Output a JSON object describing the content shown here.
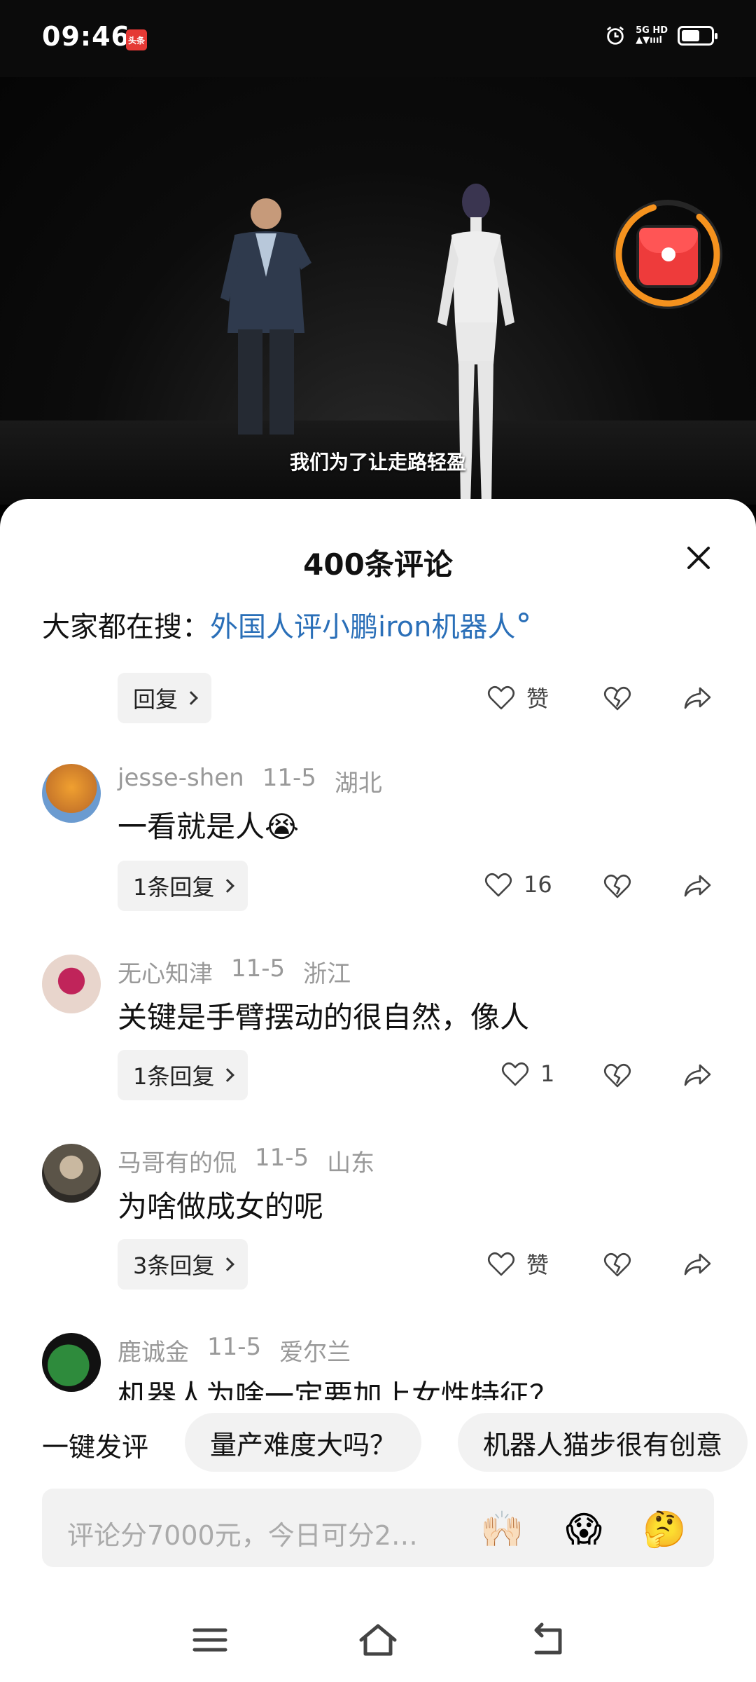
{
  "status_bar": {
    "time": "09:46",
    "app_badge": "头条",
    "network_top": "5G HD",
    "network_bottom": "▲▼ıııl",
    "battery_level": 0.55
  },
  "video": {
    "subtitle": "我们为了让走路轻盈"
  },
  "sheet": {
    "title": "400条评论",
    "search_prefix": "大家都在搜：",
    "search_link": "外国人评小鹏iron机器人"
  },
  "top_actions": {
    "reply_label": "回复",
    "like_label": "赞"
  },
  "comments": [
    {
      "user": "jesse-shen",
      "date": "11-5",
      "region": "湖北",
      "text": "一看就是人😭",
      "reply_label": "1条回复",
      "likes": "16"
    },
    {
      "user": "无心知津",
      "date": "11-5",
      "region": "浙江",
      "text": "关键是手臂摆动的很自然，像人",
      "reply_label": "1条回复",
      "likes": "1"
    },
    {
      "user": "马哥有的侃",
      "date": "11-5",
      "region": "山东",
      "text": "为啥做成女的呢",
      "reply_label": "3条回复",
      "likes": "赞"
    },
    {
      "user": "鹿诚金",
      "date": "11-5",
      "region": "爱尔兰",
      "text": "机器人为啥一定要加上女性特征？"
    }
  ],
  "quick_comment": {
    "label": "一键发评",
    "chips": [
      "量产难度大吗？",
      "机器人猫步很有创意"
    ]
  },
  "input": {
    "placeholder": "评论分7000元，今日可分2…",
    "emojis": [
      "🙌🏻",
      "😱",
      "🤔"
    ]
  },
  "colors": {
    "link": "#2a6fb8",
    "redpacket_ring": "#f5921e",
    "redpacket": "#ee3b3b"
  }
}
